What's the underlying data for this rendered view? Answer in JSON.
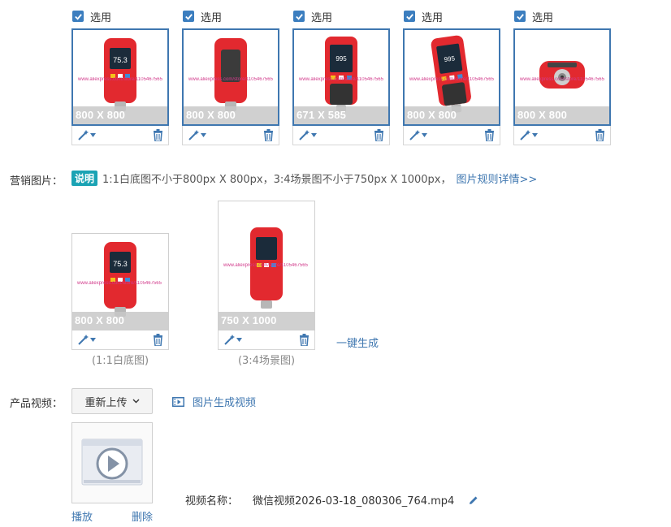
{
  "images": [
    {
      "select_label": "选用",
      "dims": "800 X 800",
      "watermark": "www.aliexpress.com/store/1105467565"
    },
    {
      "select_label": "选用",
      "dims": "800 X 800",
      "watermark": "www.aliexpress.com/store/1105467565"
    },
    {
      "select_label": "选用",
      "dims": "671 X 585",
      "watermark": "www.aliexpress.com/store/1105467565"
    },
    {
      "select_label": "选用",
      "dims": "800 X 800",
      "watermark": "www.aliexpress.com/store/1105467565"
    },
    {
      "select_label": "选用",
      "dims": "800 X 800",
      "watermark": "www.aliexpress.com/store/1105467565"
    }
  ],
  "marketing": {
    "label": "营销图片：",
    "badge": "说明",
    "rule_text": "1:1白底图不小于800px X 800px，3:4场景图不小于750px X 1000px，",
    "rule_link": "图片规则详情>>",
    "square": {
      "dims": "800 X 800",
      "caption": "(1:1白底图)",
      "watermark": "www.aliexpress.com/store/1105467565"
    },
    "scene": {
      "dims": "750 X 1000",
      "caption": "(3:4场景图)",
      "watermark": "www.aliexpress.com/store/1105467565"
    },
    "generate_link": "一键生成"
  },
  "video": {
    "label": "产品视频：",
    "reupload_button": "重新上传",
    "gen_video_link": "图片生成视频",
    "play_link": "播放",
    "delete_link": "删除",
    "name_label": "视频名称：",
    "file_name": "微信视频2026-03-18_080306_764.mp4"
  },
  "colors": {
    "accent": "#3f77b0",
    "badge": "#1ba3b4",
    "product_red": "#e2292f"
  }
}
